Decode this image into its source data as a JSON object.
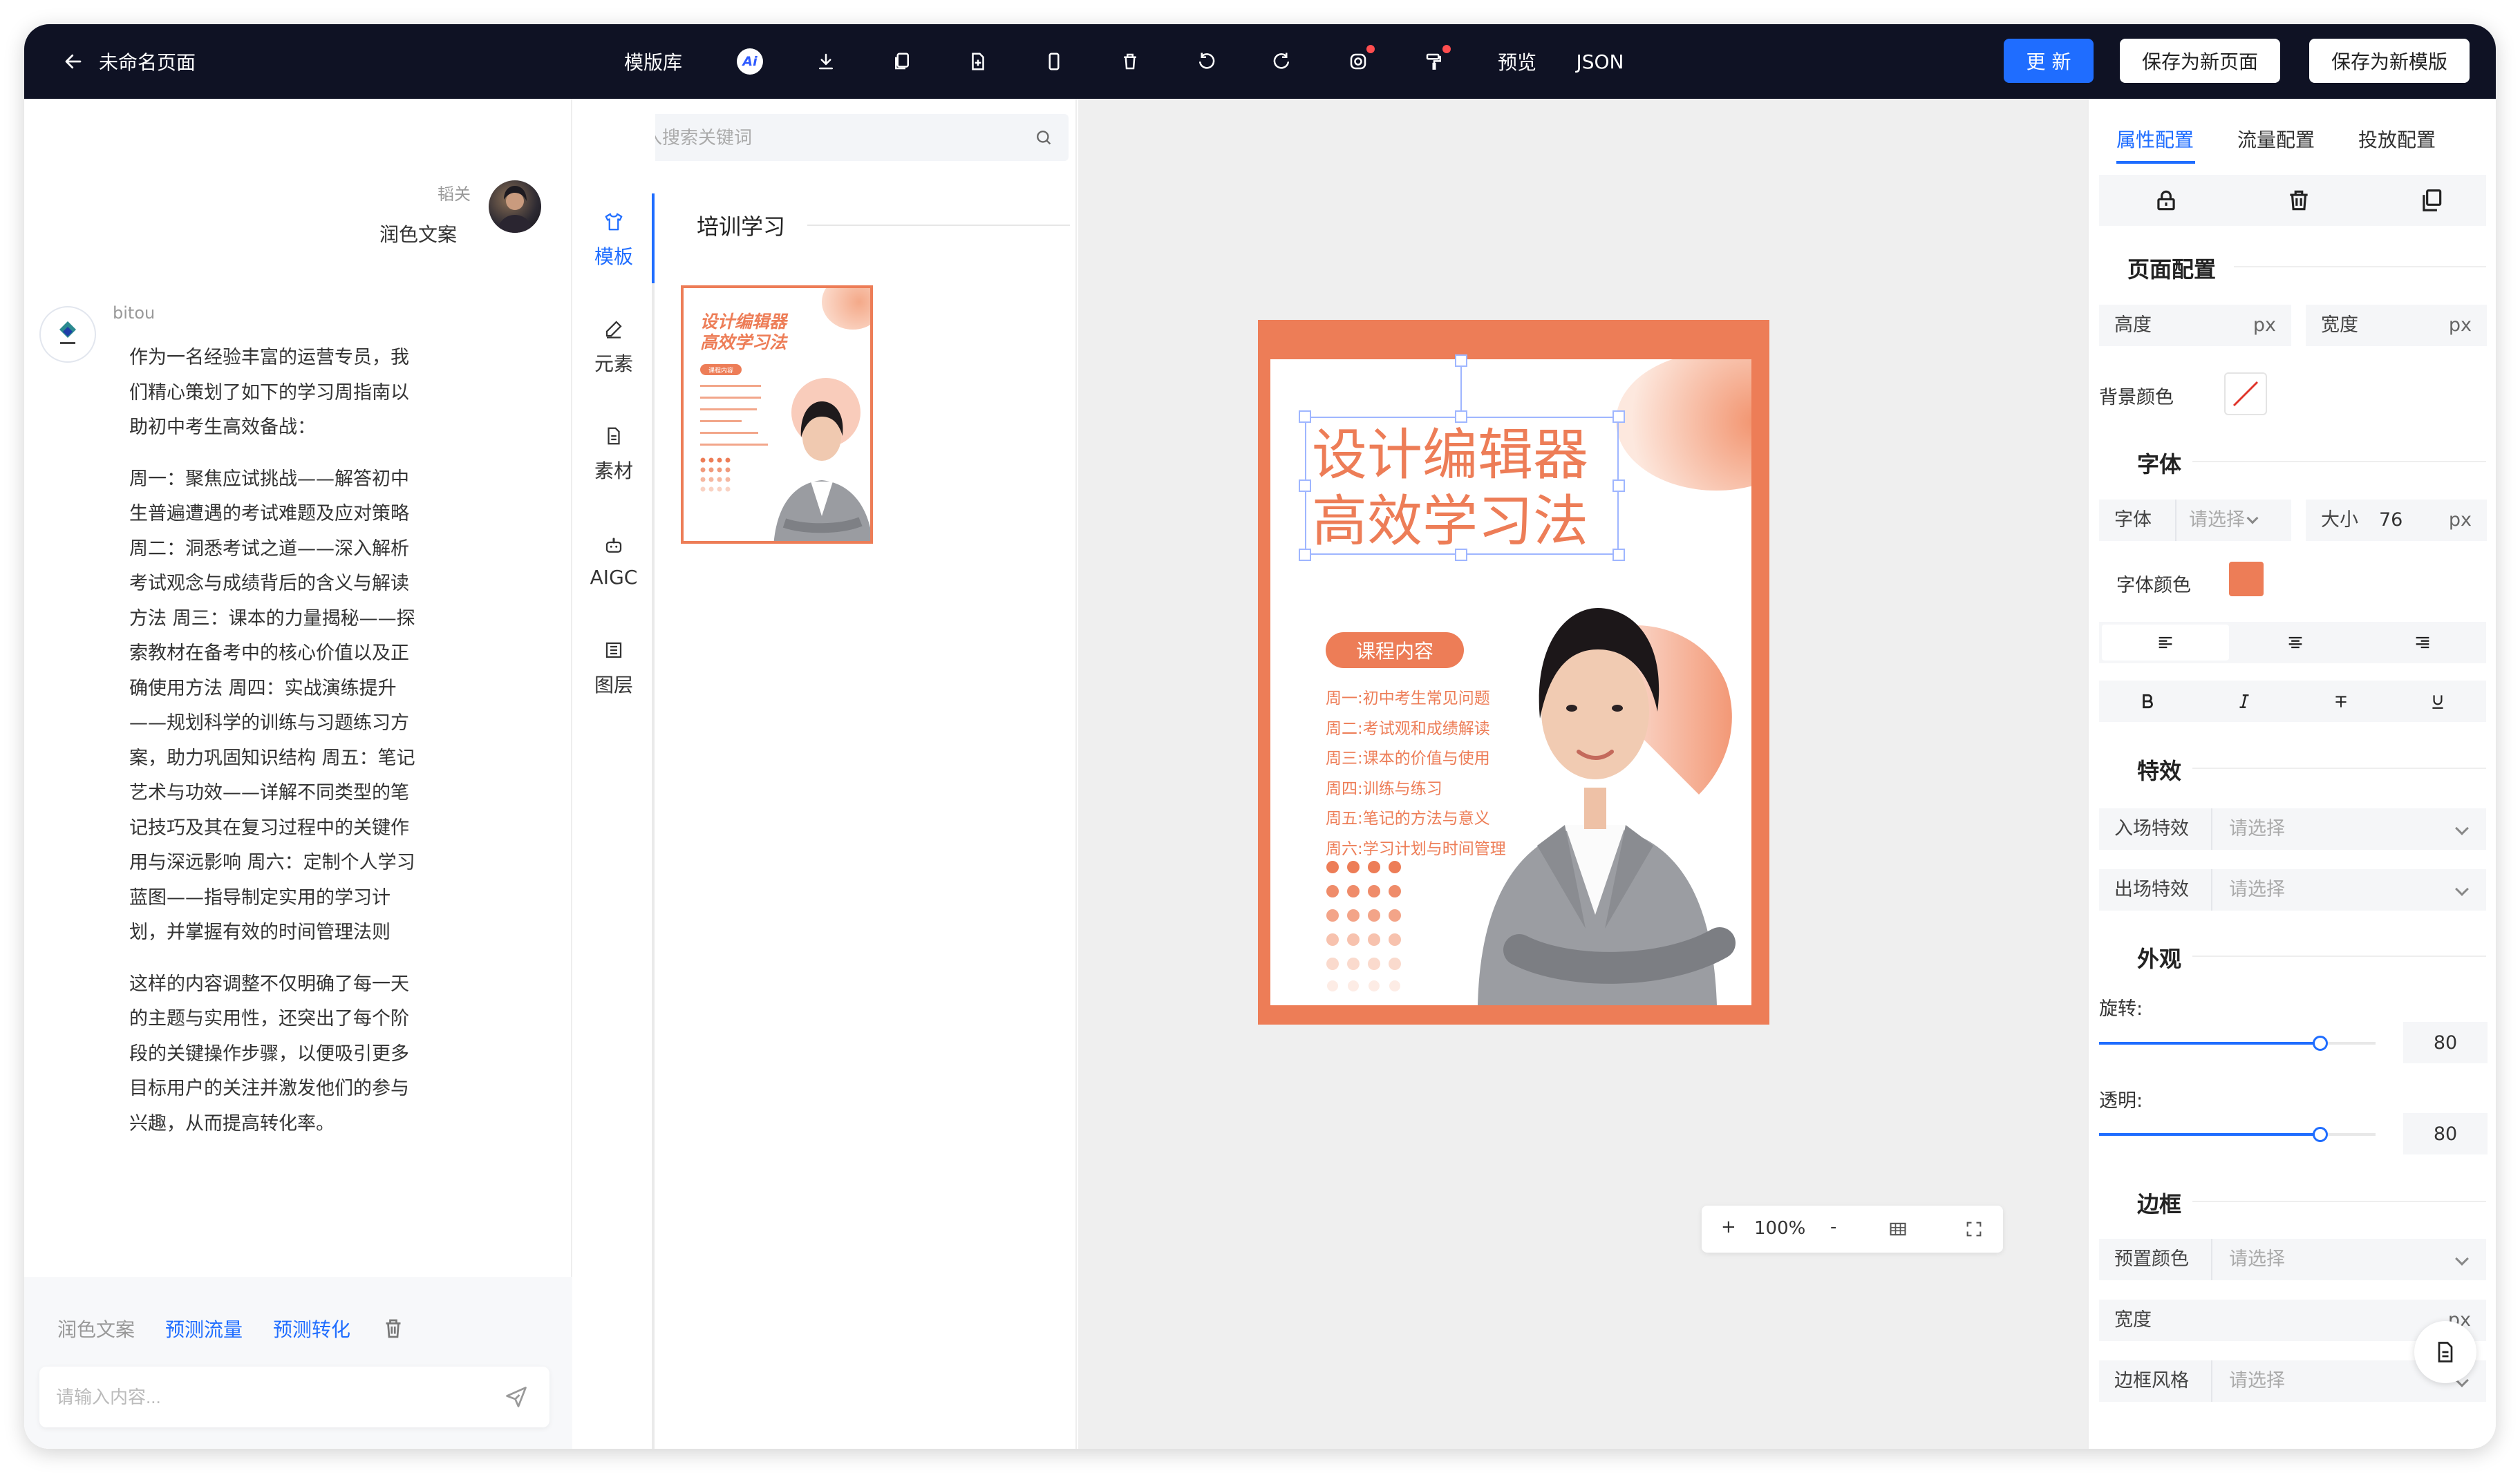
{
  "topbar": {
    "title": "未命名页面",
    "library": "模版库",
    "ai_badge": "Ai",
    "preview": "预览",
    "json": "JSON",
    "update": "更 新",
    "save_page": "保存为新页面",
    "save_template": "保存为新模版",
    "icons": [
      "download-icon",
      "copy-icon",
      "file-icon",
      "mobile-icon",
      "trash-icon",
      "undo-icon",
      "redo-icon",
      "instagram-icon",
      "paint-roller-icon"
    ],
    "notify_color": "#ff4d4f",
    "bg": "#0f1224",
    "accent": "#1f6dff"
  },
  "chat": {
    "user_tag": "韬关",
    "user_msg": "润色文案",
    "bot_name": "bitou",
    "bot_p1": "作为一名经验丰富的运营专员，我们精心策划了如下的学习周指南以助初中考生高效备战：",
    "bot_p2": "周一：聚焦应试挑战——解答初中生普遍遭遇的考试难题及应对策略 周二：洞悉考试之道——深入解析考试观念与成绩背后的含义与解读方法 周三：课本的力量揭秘——探索教材在备考中的核心价值以及正确使用方法 周四：实战演练提升——规划科学的训练与习题练习方案，助力巩固知识结构 周五：笔记艺术与功效——详解不同类型的笔记技巧及其在复习过程中的关键作用与深远影响 周六：定制个人学习蓝图——指导制定实用的学习计划，并掌握有效的时间管理法则",
    "bot_p3": "这样的内容调整不仅明确了每一天的主题与实用性，还突出了每个阶段的关键操作步骤，以便吸引更多目标用户的关注并激发他们的参与兴趣，从而提高转化率。",
    "tab_polish": "润色文案",
    "tab_traffic": "预测流量",
    "tab_convert": "预测转化",
    "input_placeholder": "请输入内容..."
  },
  "nav": {
    "items": [
      {
        "label": "模板",
        "icon": "shirt-icon"
      },
      {
        "label": "元素",
        "icon": "pen-icon"
      },
      {
        "label": "素材",
        "icon": "document-icon"
      },
      {
        "label": "AIGC",
        "icon": "robot-icon"
      },
      {
        "label": "图层",
        "icon": "layers-icon"
      }
    ],
    "active": 0
  },
  "library": {
    "search_placeholder": "请输入搜索关键词",
    "category": "培训学习",
    "thumb_title1": "设计编辑器",
    "thumb_title2": "高效学习法",
    "thumb_pill": "课程内容"
  },
  "poster": {
    "title1": "设计编辑器",
    "title2": "高效学习法",
    "pill": "课程内容",
    "items": [
      "周一:初中考生常见问题",
      "周二:考试观和成绩解读",
      "周三:课本的价值与使用",
      "周四:训练与练习",
      "周五:笔记的方法与意义",
      "周六:学习计划与时间管理"
    ],
    "color": "#ed7d57"
  },
  "zoom": {
    "plus": "+",
    "value": "100%",
    "minus": "-"
  },
  "right": {
    "tabs": [
      "属性配置",
      "流量配置",
      "投放配置"
    ],
    "page_section": "页面配置",
    "height_label": "高度",
    "width_label": "宽度",
    "unit": "px",
    "bg_color_label": "背景颜色",
    "font_section": "字体",
    "font_label": "字体",
    "font_placeholder": "请选择",
    "size_label": "大小",
    "size_value": "76",
    "font_color_label": "字体颜色",
    "font_color": "#ed7d57",
    "effects_section": "特效",
    "enter_label": "入场特效",
    "exit_label": "出场特效",
    "select_placeholder": "请选择",
    "look_section": "外观",
    "rotate_label": "旋转:",
    "rotate_value": "80",
    "rotate_fraction": 0.8,
    "opacity_label": "透明:",
    "opacity_value": "80",
    "opacity_fraction": 0.8,
    "border_section": "边框",
    "preset_color_label": "预置颜色",
    "border_width_label": "宽度",
    "border_style_label": "边框风格"
  }
}
